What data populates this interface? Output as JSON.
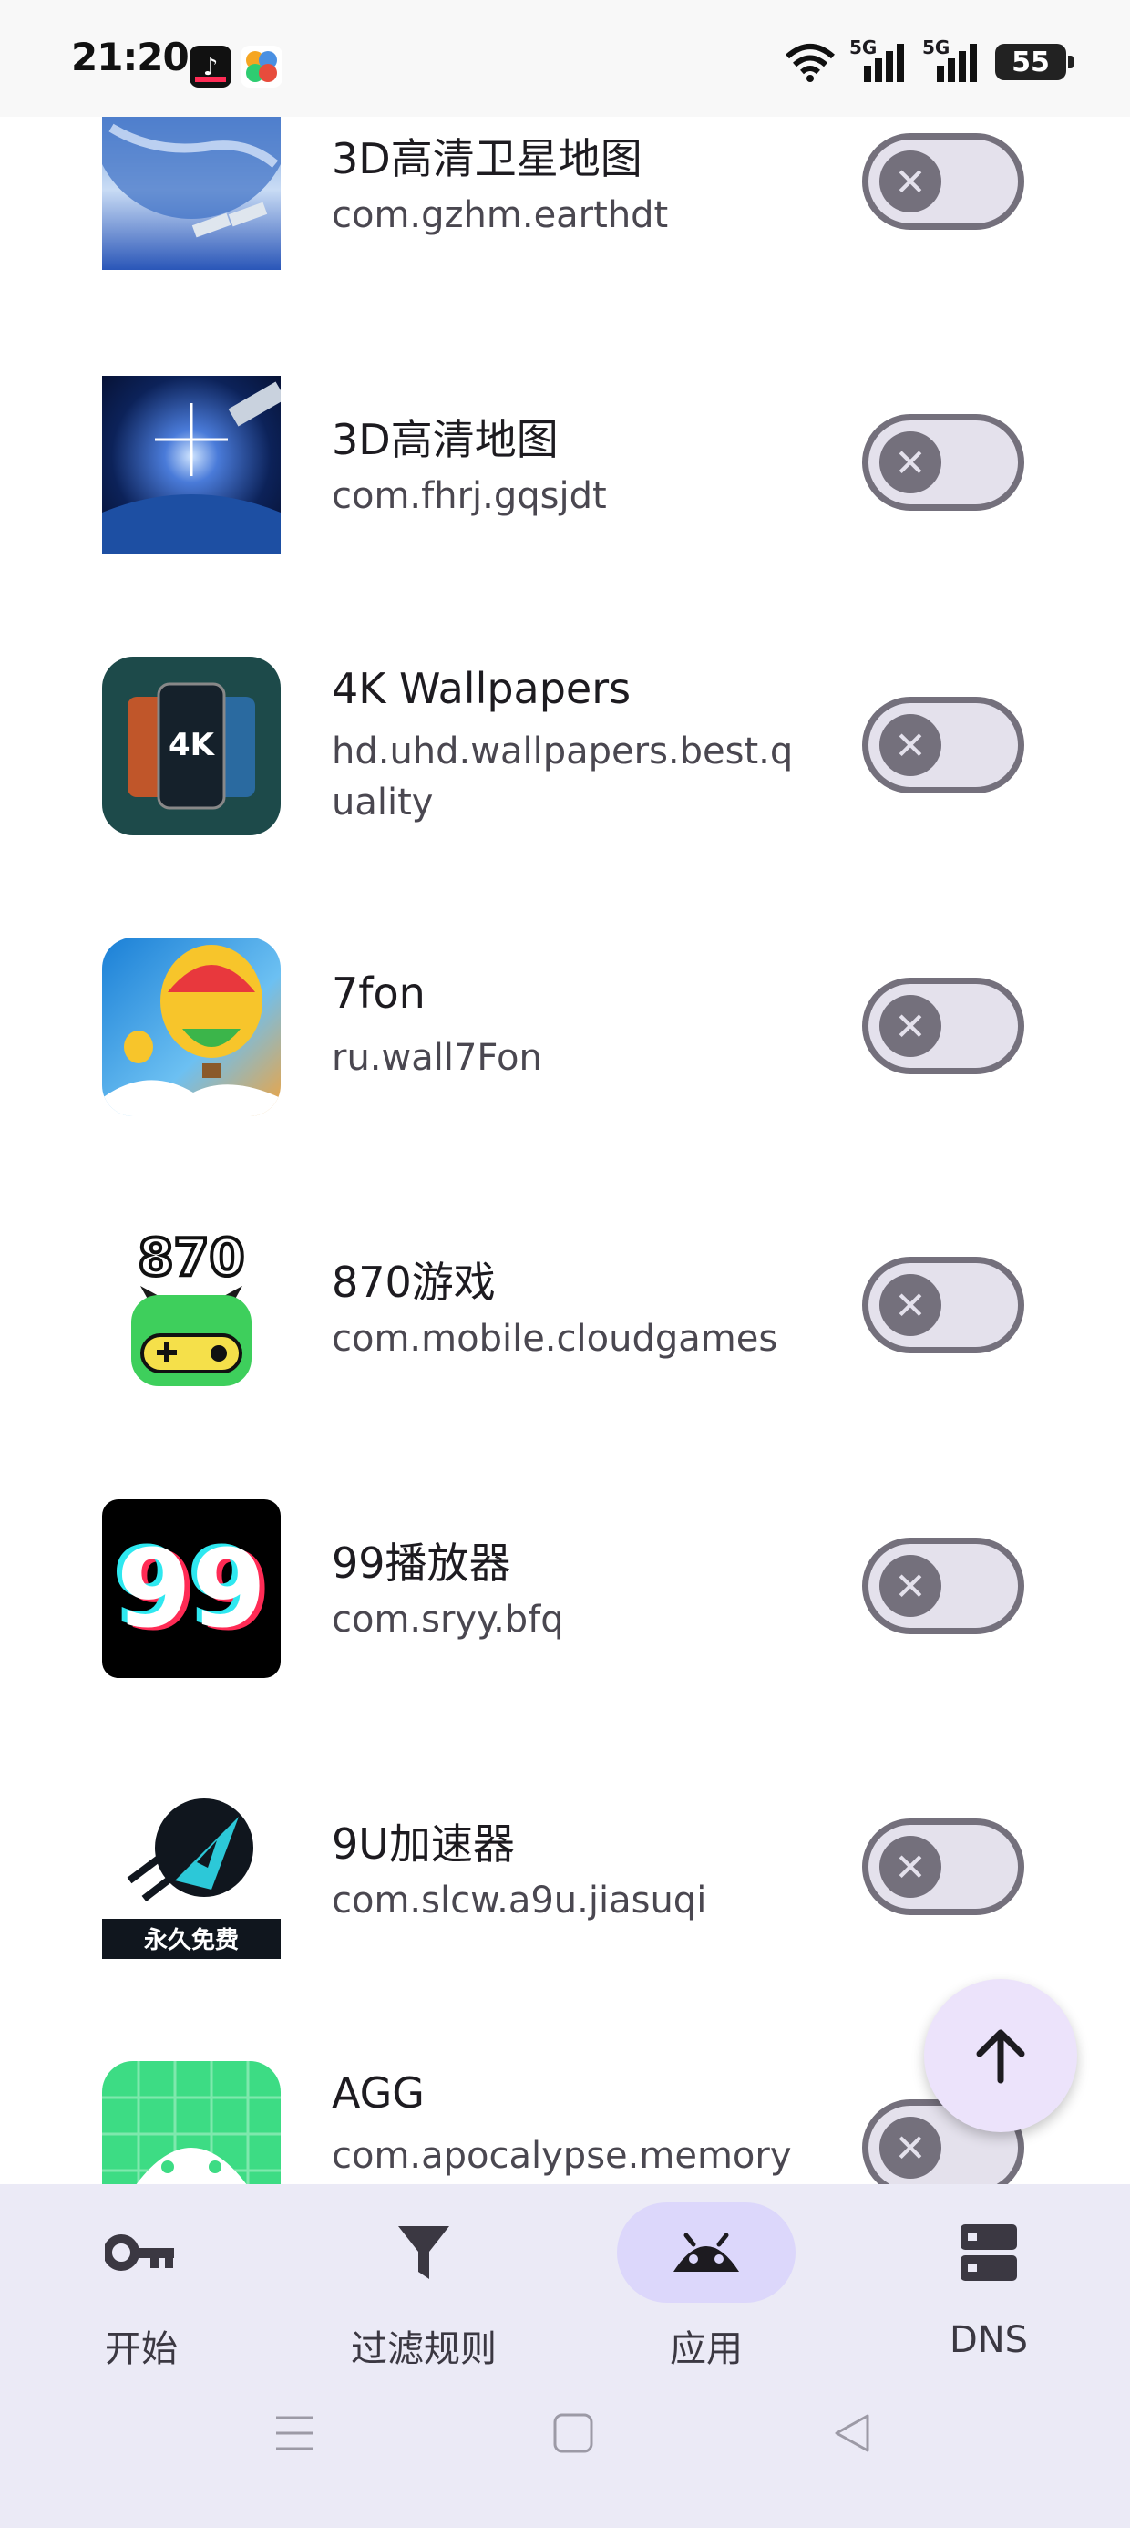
{
  "status_bar": {
    "time": "21:20",
    "battery": "55",
    "signal_1": "5G",
    "signal_2": "5G"
  },
  "apps": [
    {
      "name": "3D高清卫星地图",
      "package": "com.gzhm.earthdt",
      "enabled": false
    },
    {
      "name": "3D高清地图",
      "package": "com.fhrj.gqsjdt",
      "enabled": false
    },
    {
      "name": "4K Wallpapers",
      "package": "hd.uhd.wallpapers.best.quality",
      "enabled": false,
      "icon_text": "4K"
    },
    {
      "name": "7fon",
      "package": "ru.wall7Fon",
      "enabled": false
    },
    {
      "name": "870游戏",
      "package": "com.mobile.cloudgames",
      "enabled": false,
      "icon_text": "870"
    },
    {
      "name": "99播放器",
      "package": "com.sryy.bfq",
      "enabled": false,
      "icon_text": "99"
    },
    {
      "name": "9U加速器",
      "package": "com.slcw.a9u.jiasuqi",
      "enabled": false,
      "icon_text": "永久免费"
    },
    {
      "name": "AGG",
      "package": "com.apocalypse.memory",
      "enabled": false
    }
  ],
  "toggle_off_glyph": "✕",
  "bottom_nav": [
    {
      "label": "开始",
      "icon": "key-icon",
      "active": false
    },
    {
      "label": "过滤规则",
      "icon": "filter-icon",
      "active": false
    },
    {
      "label": "应用",
      "icon": "android-icon",
      "active": true
    },
    {
      "label": "DNS",
      "icon": "dns-icon",
      "active": false
    }
  ],
  "colors": {
    "accent_pill": "#dcd7fb",
    "fab_bg": "#ece3fb",
    "toggle_off": "#74707c",
    "nav_bg": "#ebeaf6"
  }
}
